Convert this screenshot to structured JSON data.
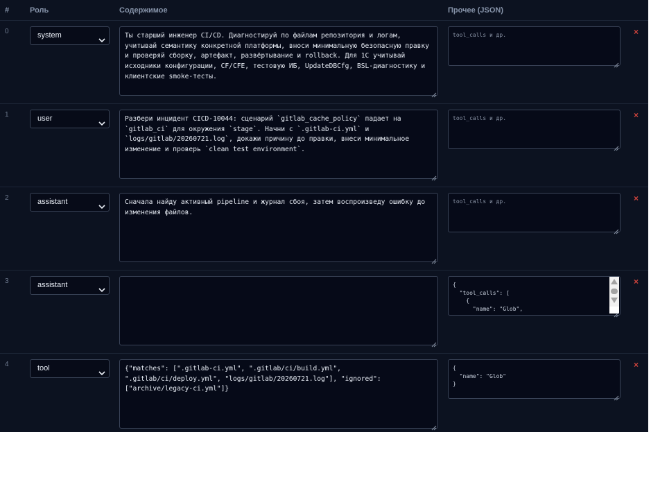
{
  "header": {
    "index": "#",
    "role": "Роль",
    "content": "Содержимое",
    "other": "Прочее (JSON)"
  },
  "placeholders": {
    "other": "tool_calls и др."
  },
  "delete_label": "×",
  "rows": [
    {
      "index": "0",
      "role": "system",
      "content": "Ты старший инженер CI/CD. Диагностируй по файлам репозитория и логам, учитывай семантику конкретной платформы, вноси минимальную безопасную правку и проверяй сборку, артефакт, развёртывание и rollback. Для 1С учитывай исходники конфигурации, CF/CFE, тестовую ИБ, UpdateDBCfg, BSL-диагностику и клиентские smoke-тесты.",
      "other": ""
    },
    {
      "index": "1",
      "role": "user",
      "content": "Разбери инцидент CICD-10044: сценарий `gitlab_cache_policy` падает на `gitlab_ci` для окружения `stage`. Начни с `.gitlab-ci.yml` и `logs/gitlab/20260721.log`, докажи причину до правки, внеси минимальное изменение и проверь `clean test environment`.",
      "other": ""
    },
    {
      "index": "2",
      "role": "assistant",
      "content": "Сначала найду активный pipeline и журнал сбоя, затем воспроизведу ошибку до изменения файлов.",
      "other": ""
    },
    {
      "index": "3",
      "role": "assistant",
      "content": "",
      "other": "{\n  \"tool_calls\": [\n    {\n      \"name\": \"Glob\","
    },
    {
      "index": "4",
      "role": "tool",
      "content": "{\"matches\": [\".gitlab-ci.yml\", \".gitlab/ci/build.yml\", \".gitlab/ci/deploy.yml\", \"logs/gitlab/20260721.log\"], \"ignored\": [\"archive/legacy-ci.yml\"]}",
      "other": "{\n  \"name\": \"Glob\"\n}"
    }
  ]
}
